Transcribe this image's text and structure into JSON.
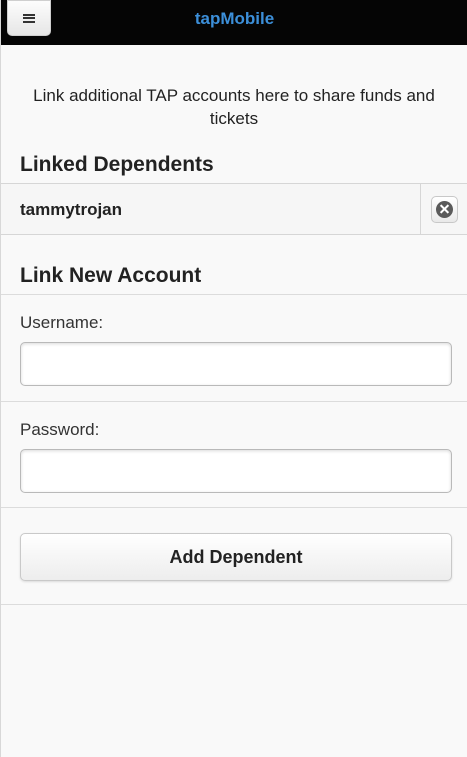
{
  "header": {
    "title": "tapMobile",
    "menu_icon": "hamburger-menu-icon"
  },
  "intro": {
    "text": "Link additional TAP accounts here to share funds and tickets"
  },
  "linked_dependents": {
    "title": "Linked Dependents",
    "items": [
      {
        "username": "tammytrojan",
        "remove_icon": "close-circle-icon"
      }
    ]
  },
  "link_new_account": {
    "title": "Link New Account",
    "username_label": "Username:",
    "username_value": "",
    "password_label": "Password:",
    "password_value": "",
    "submit_label": "Add Dependent"
  },
  "colors": {
    "header_bg": "#050505",
    "title_accent": "#3c8fd9",
    "page_bg": "#f9f9f9"
  }
}
